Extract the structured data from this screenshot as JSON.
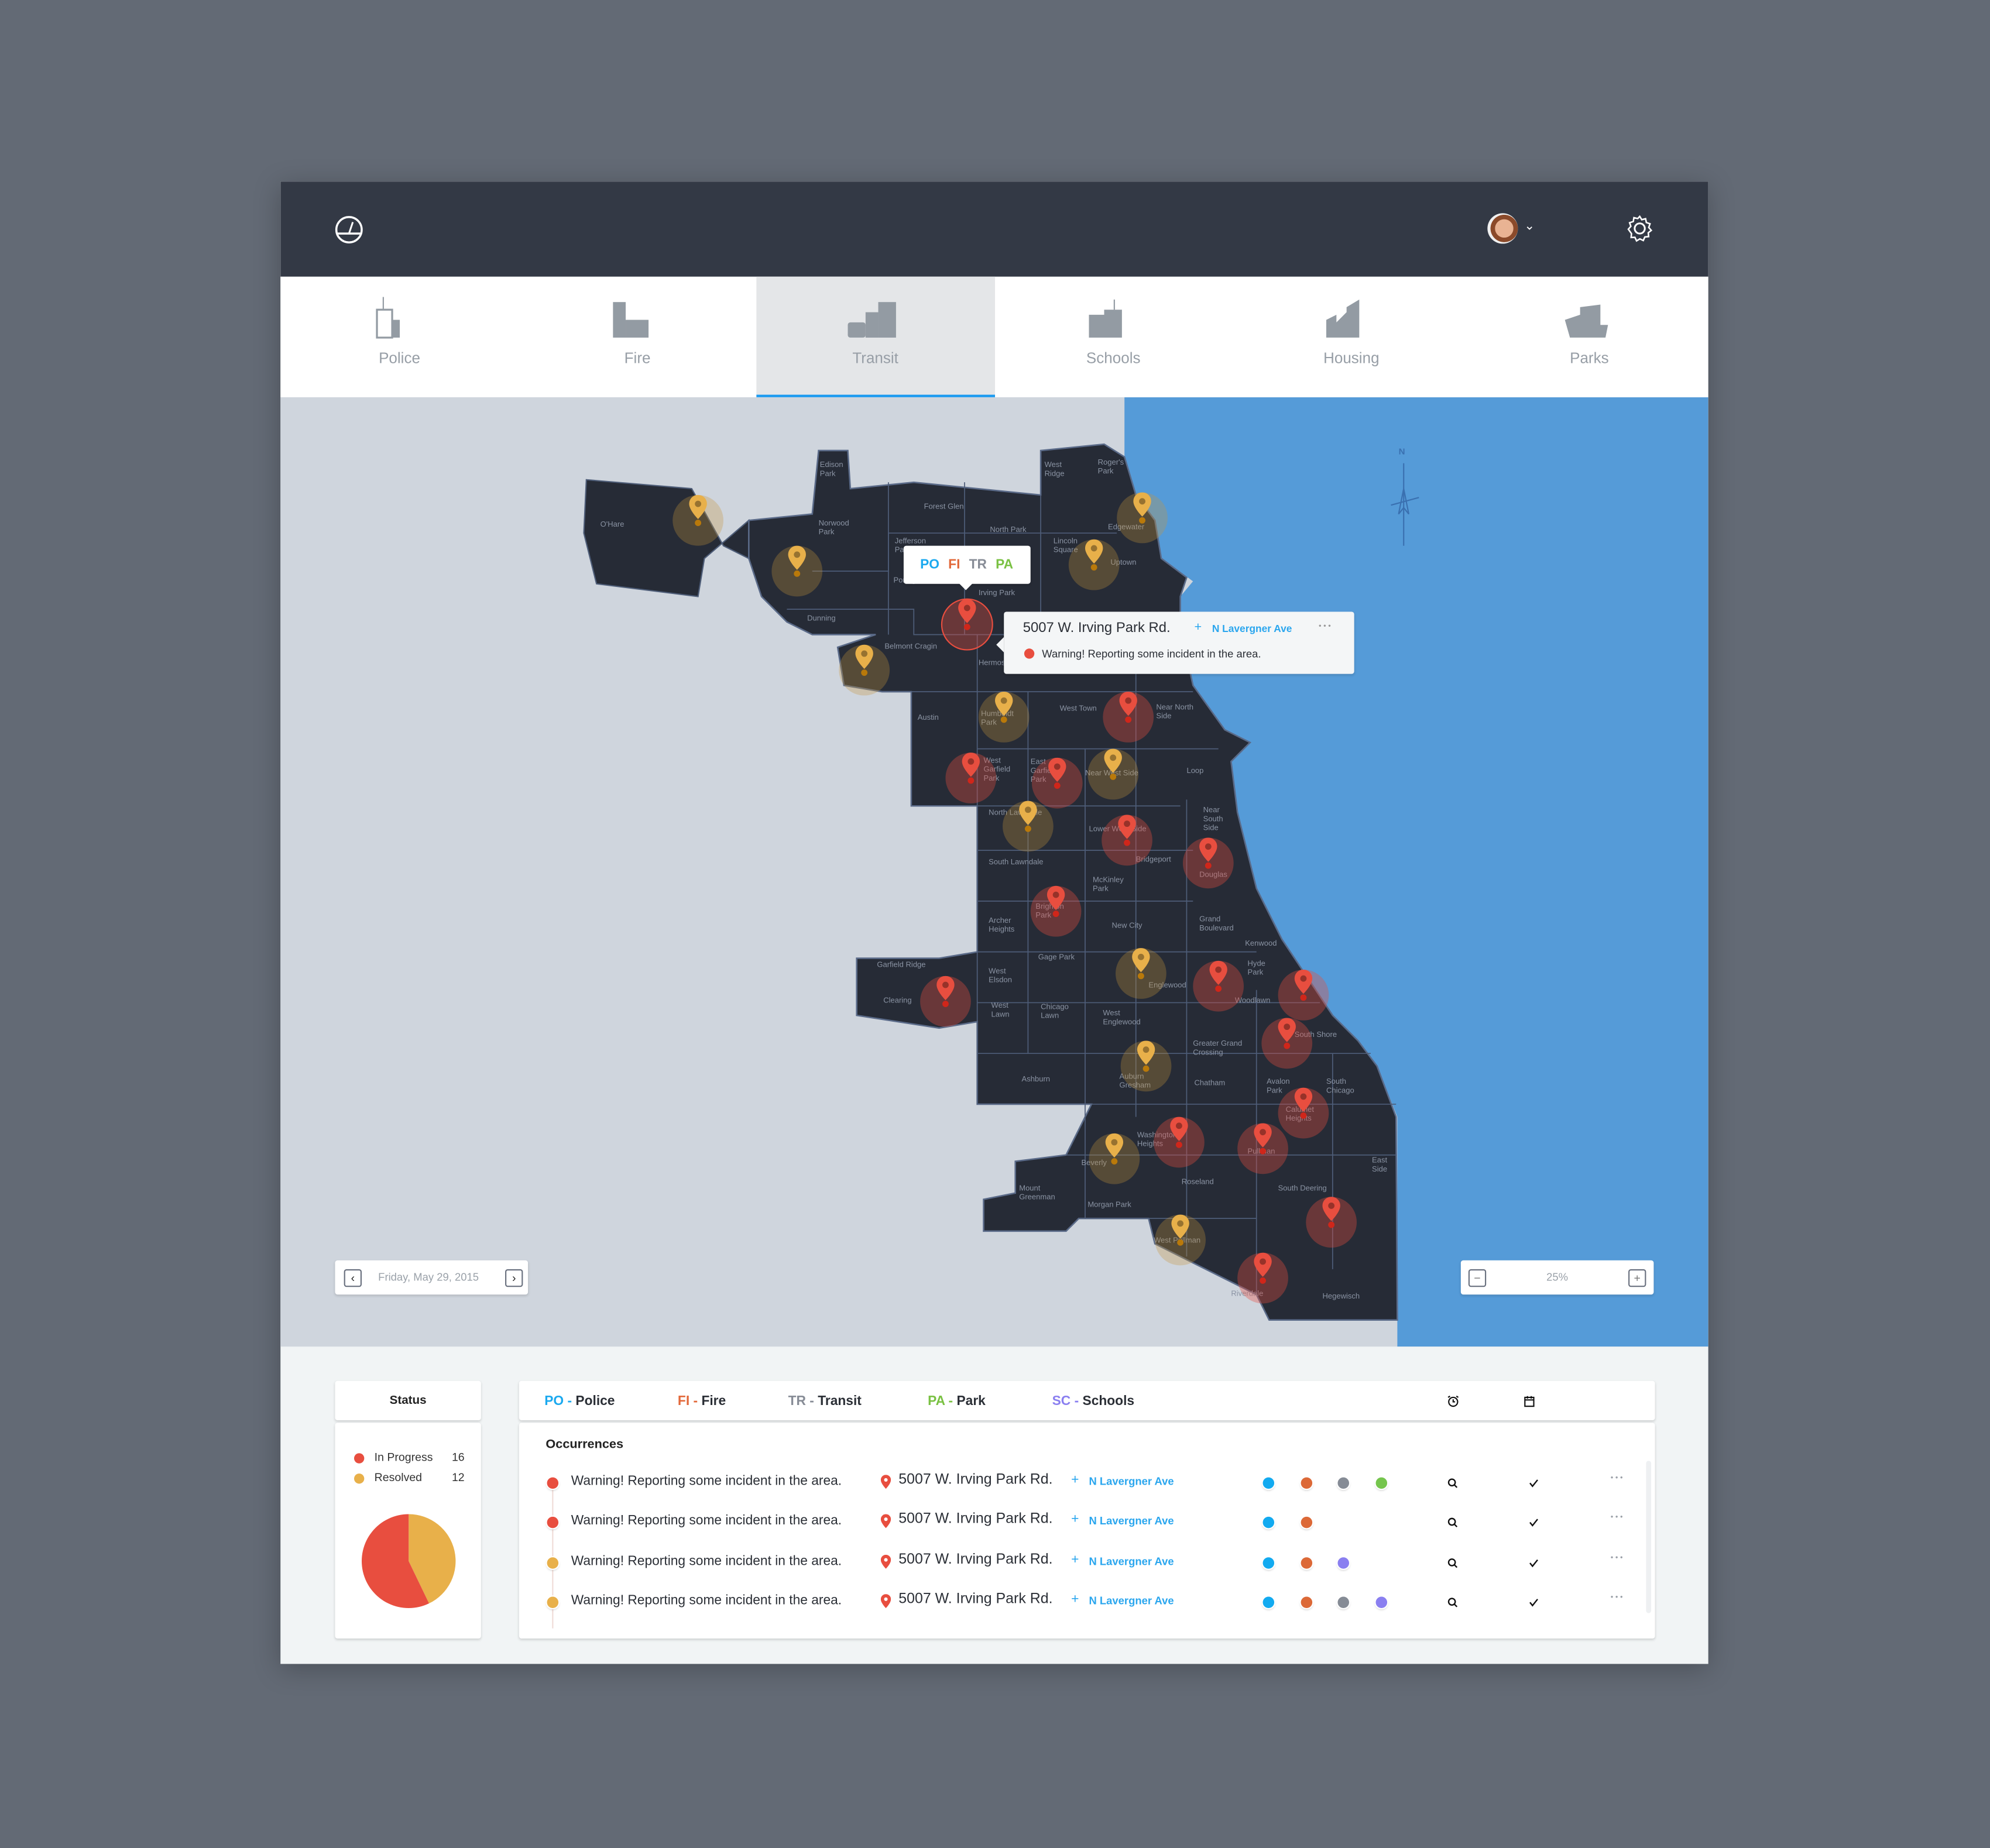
{
  "header": {
    "logo_icon": "compass-logo-icon",
    "avatar": "user-avatar",
    "settings_icon": "gear-icon"
  },
  "tabs": [
    {
      "label": "Police",
      "icon": "police-building-icon",
      "active": false
    },
    {
      "label": "Fire",
      "icon": "fire-station-icon",
      "active": false
    },
    {
      "label": "Transit",
      "icon": "transit-bus-icon",
      "active": true
    },
    {
      "label": "Schools",
      "icon": "school-building-icon",
      "active": false
    },
    {
      "label": "Housing",
      "icon": "housing-building-icon",
      "active": false
    },
    {
      "label": "Parks",
      "icon": "parks-icon",
      "active": false
    }
  ],
  "map": {
    "compass_label": "N",
    "neighborhoods": [
      "O'Hare",
      "Edison\nPark",
      "Norwood\nPark",
      "Forest Glen",
      "Jefferson\nPark",
      "West\nRidge",
      "Roger's\nPark",
      "Edgewater",
      "North Park",
      "Lincoln\nSquare",
      "Uptown",
      "Irving Park",
      "Portage Park",
      "Dunning",
      "Belmont Cragin",
      "Hermosa",
      "Austin",
      "Humboldt\nPark",
      "West Town",
      "Near North\nSide",
      "West\nGarfield\nPark",
      "East\nGarfield\nPark",
      "Near West Side",
      "Loop",
      "North Lawndale",
      "Lower West Side",
      "Near\nSouth\nSide",
      "South Lawndale",
      "Bridgeport",
      "Douglas",
      "McKinley\nPark",
      "Brighton\nPark",
      "Archer\nHeights",
      "New City",
      "Grand\nBoulevard",
      "Kenwood",
      "Garfield Ridge",
      "Gage Park",
      "Hyde\nPark",
      "West\nElsdon",
      "Englewood",
      "Clearing",
      "West\nLawn",
      "Chicago\nLawn",
      "West\nEnglewood",
      "Woodlawn",
      "Greater Grand\nCrossing",
      "South Shore",
      "Ashburn",
      "Auburn\nGresham",
      "Chatham",
      "Avalon\nPark",
      "South\nChicago",
      "Calumet\nHeights",
      "Washington\nHeights",
      "Beverly",
      "Pullman",
      "Roseland",
      "Mount\nGreenman",
      "Morgan Park",
      "South Deering",
      "East\nSide",
      "West Pullman",
      "Riverdale",
      "Hegewisch"
    ],
    "category_popup": {
      "items": [
        {
          "code": "PO",
          "color": "#1ba9ef"
        },
        {
          "code": "FI",
          "color": "#e2683a"
        },
        {
          "code": "TR",
          "color": "#878c96"
        },
        {
          "code": "PA",
          "color": "#7ac143"
        }
      ]
    },
    "incident_popup": {
      "address": "5007 W. Irving Park Rd.",
      "plus": "+",
      "cross_street": "N Lavergner Ave",
      "warning_bold": "Warning!",
      "warning_text": " Reporting some incident in the area.",
      "more": "• • •"
    },
    "date_control": {
      "value": "Friday, May 29, 2015",
      "prev": "‹",
      "next": "›"
    },
    "zoom_control": {
      "value": "25%",
      "minus": "−",
      "plus": "+"
    }
  },
  "status": {
    "title": "Status",
    "legend": [
      {
        "label": "In Progress",
        "count": "16",
        "value": 16,
        "color": "#e84e3f"
      },
      {
        "label": "Resolved",
        "count": "12",
        "value": 12,
        "color": "#e8b04a"
      }
    ]
  },
  "filters": [
    {
      "code": "PO",
      "sep": " - ",
      "name": "Police",
      "color": "#1ba9ef"
    },
    {
      "code": "FI",
      "sep": " - ",
      "name": "Fire",
      "color": "#e2683a"
    },
    {
      "code": "TR",
      "sep": " - ",
      "name": "Transit",
      "color": "#878c96"
    },
    {
      "code": "PA",
      "sep": " - ",
      "name": "Park",
      "color": "#7ac143"
    },
    {
      "code": "SC",
      "sep": " - ",
      "name": "Schools",
      "color": "#8a7ff0"
    }
  ],
  "toolbar": {
    "alarm_icon": "alarm-clock-icon",
    "calendar_icon": "calendar-icon",
    "refresh_icon": "refresh-icon"
  },
  "occurrences": {
    "title": "Occurrences",
    "rows": [
      {
        "status": "in-progress",
        "status_color": "#e84e3f",
        "text": "Warning! Reporting some incident in the area.",
        "address": "5007 W. Irving Park Rd.",
        "plus": "+",
        "street": "N Lavergner Ave",
        "categories": [
          "#12aaf0",
          "#dc6937",
          "#858b95",
          "#75c54d"
        ],
        "more": "• • •"
      },
      {
        "status": "in-progress",
        "status_color": "#e84e3f",
        "text": "Warning! Reporting some incident in the area.",
        "address": "5007 W. Irving Park Rd.",
        "plus": "+",
        "street": "N Lavergner Ave",
        "categories": [
          "#12aaf0",
          "#dc6937"
        ],
        "more": "• • •"
      },
      {
        "status": "resolved",
        "status_color": "#e8b04a",
        "text": "Warning! Reporting some incident in the area.",
        "address": "5007 W. Irving Park Rd.",
        "plus": "+",
        "street": "N Lavergner Ave",
        "categories": [
          "#12aaf0",
          "#dc6937",
          "#8a7ff0"
        ],
        "more": "• • •"
      },
      {
        "status": "resolved",
        "status_color": "#e8b04a",
        "text": "Warning! Reporting some incident in the area.",
        "address": "5007 W. Irving Park Rd.",
        "plus": "+",
        "street": "N Lavergner Ave",
        "categories": [
          "#12aaf0",
          "#dc6937",
          "#858b95",
          "#8a7ff0"
        ],
        "more": "• • •"
      }
    ]
  }
}
